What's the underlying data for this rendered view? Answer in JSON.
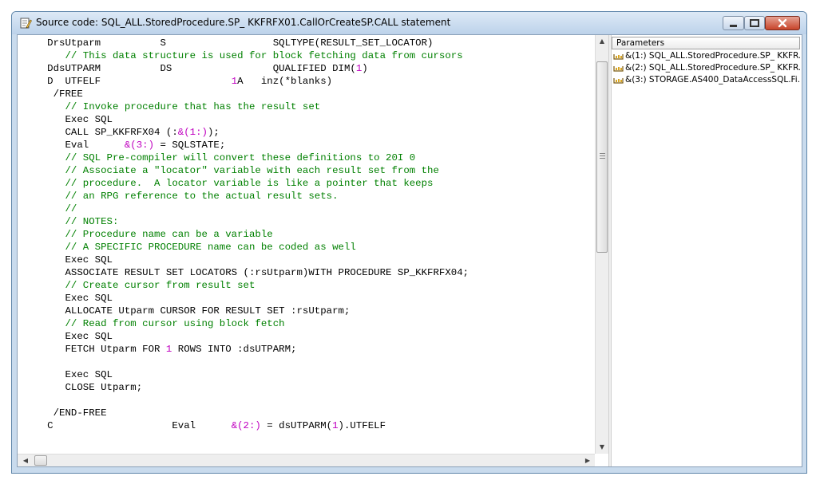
{
  "window": {
    "title": "Source code: SQL_ALL.StoredProcedure.SP_ KKFRFX01.CallOrCreateSP.CALL statement"
  },
  "code": {
    "lines": [
      [
        {
          "t": "     DrsUtparm          S                  SQLTYPE(RESULT_SET_LOCATOR)",
          "k": "n"
        }
      ],
      [
        {
          "t": "        // This data structure is used for block fetching data from cursors",
          "k": "c"
        }
      ],
      [
        {
          "t": "     DdsUTPARM          DS                 QUALIFIED DIM(",
          "k": "n"
        },
        {
          "t": "1",
          "k": "v"
        },
        {
          "t": ")",
          "k": "n"
        }
      ],
      [
        {
          "t": "     D  UTFELF                      ",
          "k": "n"
        },
        {
          "t": "1",
          "k": "v"
        },
        {
          "t": "A   inz(*blanks)",
          "k": "n"
        }
      ],
      [
        {
          "t": "      /FREE",
          "k": "n"
        }
      ],
      [
        {
          "t": "        // Invoke procedure that has the result set",
          "k": "c"
        }
      ],
      [
        {
          "t": "        Exec SQL",
          "k": "n"
        }
      ],
      [
        {
          "t": "        CALL SP_KKFRFX04 (:",
          "k": "n"
        },
        {
          "t": "&(1:)",
          "k": "v"
        },
        {
          "t": ");",
          "k": "n"
        }
      ],
      [
        {
          "t": "        Eval      ",
          "k": "n"
        },
        {
          "t": "&(3:)",
          "k": "v"
        },
        {
          "t": " = SQLSTATE;",
          "k": "n"
        }
      ],
      [
        {
          "t": "        // SQL Pre-compiler will convert these definitions to 20I 0",
          "k": "c"
        }
      ],
      [
        {
          "t": "        // Associate a \"locator\" variable with each result set from the",
          "k": "c"
        }
      ],
      [
        {
          "t": "        // procedure.  A locator variable is like a pointer that keeps",
          "k": "c"
        }
      ],
      [
        {
          "t": "        // an RPG reference to the actual result sets.",
          "k": "c"
        }
      ],
      [
        {
          "t": "        //",
          "k": "c"
        }
      ],
      [
        {
          "t": "        // NOTES:",
          "k": "c"
        }
      ],
      [
        {
          "t": "        // Procedure name can be a variable",
          "k": "c"
        }
      ],
      [
        {
          "t": "        // A SPECIFIC PROCEDURE name can be coded as well",
          "k": "c"
        }
      ],
      [
        {
          "t": "        Exec SQL",
          "k": "n"
        }
      ],
      [
        {
          "t": "        ASSOCIATE RESULT SET LOCATORS (:rsUtparm)WITH PROCEDURE SP_KKFRFX04;",
          "k": "n"
        }
      ],
      [
        {
          "t": "        // Create cursor from result set",
          "k": "c"
        }
      ],
      [
        {
          "t": "        Exec SQL",
          "k": "n"
        }
      ],
      [
        {
          "t": "        ALLOCATE Utparm CURSOR FOR RESULT SET :rsUtparm;",
          "k": "n"
        }
      ],
      [
        {
          "t": "        // Read from cursor using block fetch",
          "k": "c"
        }
      ],
      [
        {
          "t": "        Exec SQL",
          "k": "n"
        }
      ],
      [
        {
          "t": "        FETCH Utparm FOR ",
          "k": "n"
        },
        {
          "t": "1",
          "k": "v"
        },
        {
          "t": " ROWS INTO :dsUTPARM;",
          "k": "n"
        }
      ],
      [
        {
          "t": "",
          "k": "n"
        }
      ],
      [
        {
          "t": "        Exec SQL",
          "k": "n"
        }
      ],
      [
        {
          "t": "        CLOSE Utparm;",
          "k": "n"
        }
      ],
      [
        {
          "t": "",
          "k": "n"
        }
      ],
      [
        {
          "t": "      /END-FREE",
          "k": "n"
        }
      ],
      [
        {
          "t": "     C                    Eval      ",
          "k": "n"
        },
        {
          "t": "&(2:)",
          "k": "v"
        },
        {
          "t": " = dsUTPARM(",
          "k": "n"
        },
        {
          "t": "1",
          "k": "v"
        },
        {
          "t": ").UTFELF",
          "k": "n"
        }
      ]
    ]
  },
  "params": {
    "header": "Parameters",
    "items": [
      "&(1:) SQL_ALL.StoredProcedure.SP_ KKFR...",
      "&(2:) SQL_ALL.StoredProcedure.SP_ KKFR...",
      "&(3:) STORAGE.AS400_DataAccessSQL.Fi..."
    ]
  },
  "colors": {
    "normal": "#000000",
    "comment": "#008000",
    "variable": "#c000c0"
  },
  "icons": {
    "title": "edit-document-icon",
    "param": "variable-icon"
  }
}
